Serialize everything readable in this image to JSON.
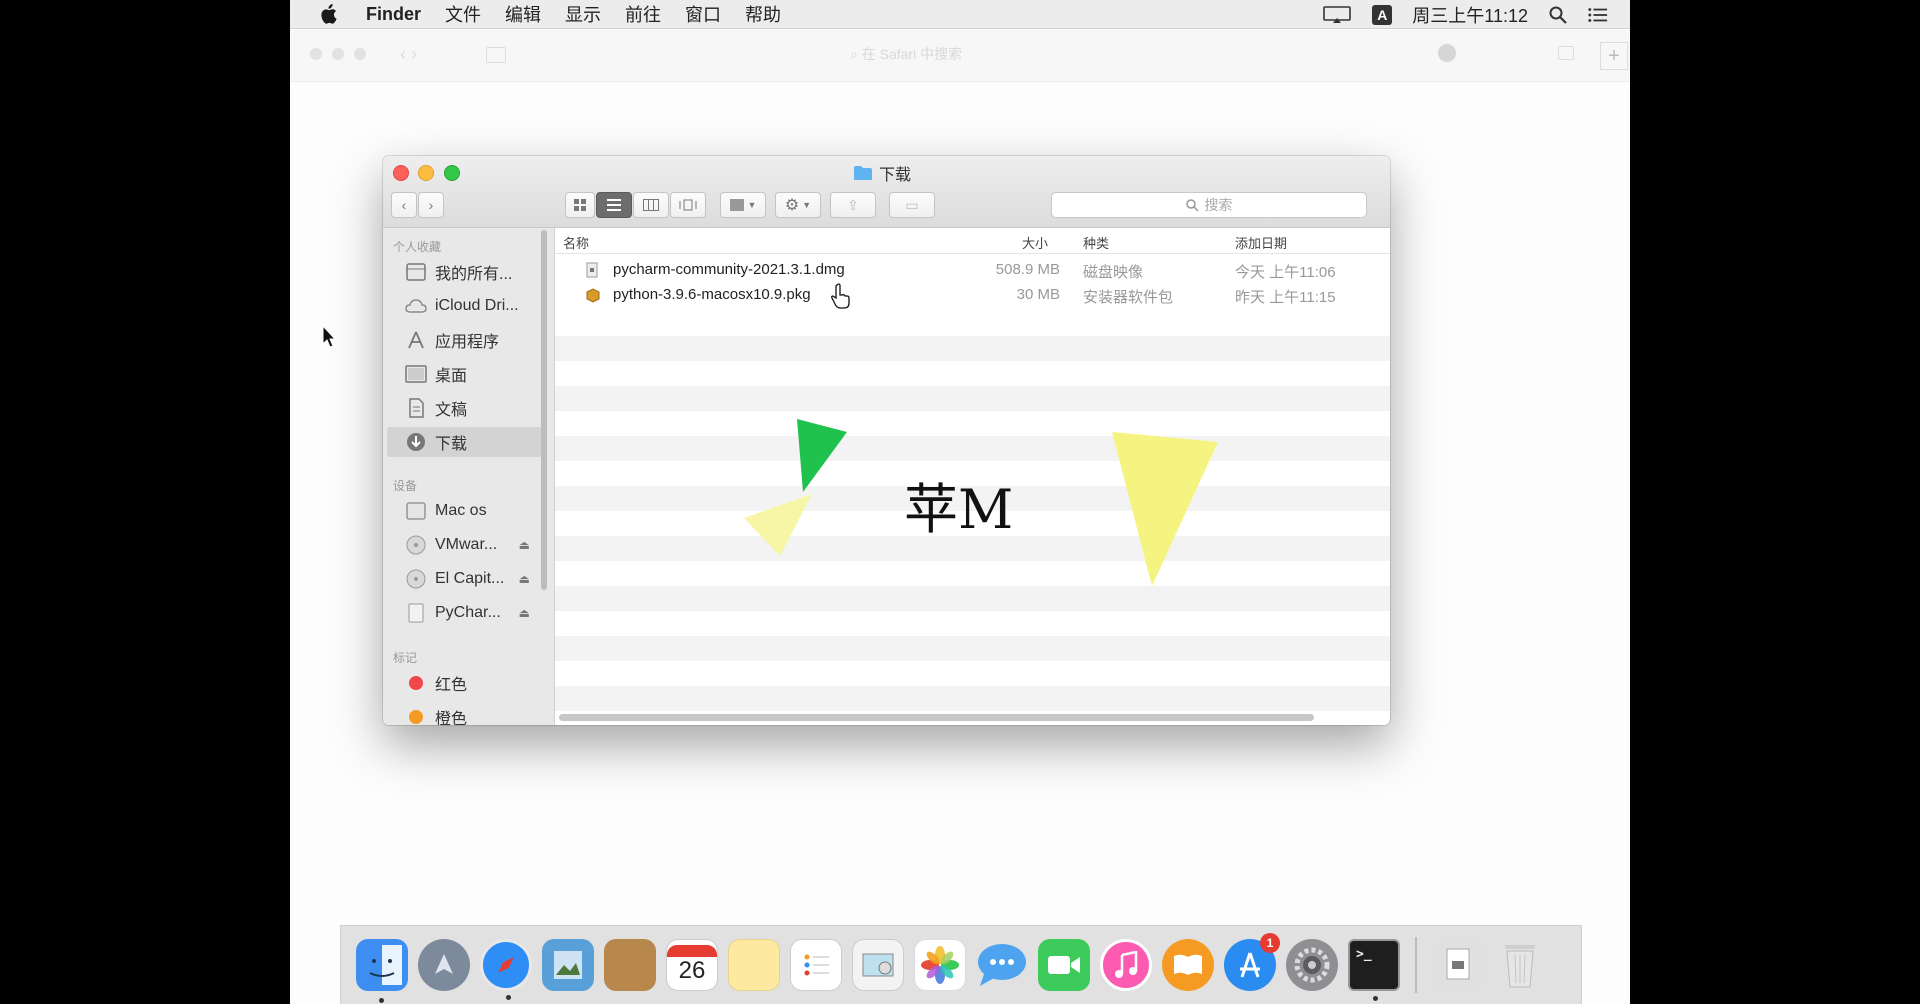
{
  "menubar": {
    "app_name": "Finder",
    "items": [
      "文件",
      "编辑",
      "显示",
      "前往",
      "窗口",
      "帮助"
    ],
    "input_method": "A",
    "clock": "周三上午11:12"
  },
  "browser": {
    "address_placeholder": "在 Safari 中搜索"
  },
  "finder": {
    "title": "下载",
    "search_placeholder": "搜索",
    "sidebar": {
      "section_favorites": "个人收藏",
      "favorites": [
        {
          "label": "我的所有...",
          "icon": "all-files-icon"
        },
        {
          "label": "iCloud Dri...",
          "icon": "cloud-icon"
        },
        {
          "label": "应用程序",
          "icon": "applications-icon"
        },
        {
          "label": "桌面",
          "icon": "desktop-icon"
        },
        {
          "label": "文稿",
          "icon": "documents-icon"
        },
        {
          "label": "下载",
          "icon": "downloads-icon"
        }
      ],
      "section_devices": "设备",
      "devices": [
        {
          "label": "Mac os",
          "icon": "hard-drive-icon"
        },
        {
          "label": "VMwar...",
          "icon": "disc-icon"
        },
        {
          "label": "El Capit...",
          "icon": "disc-icon"
        },
        {
          "label": "PyChar...",
          "icon": "disk-image-icon"
        }
      ],
      "section_tags": "标记",
      "tags": [
        {
          "label": "红色",
          "color": "#f0474a"
        },
        {
          "label": "橙色",
          "color": "#f59a23"
        }
      ]
    },
    "columns": {
      "name": "名称",
      "size": "大小",
      "kind": "种类",
      "date_added": "添加日期"
    },
    "files": [
      {
        "name": "pycharm-community-2021.3.1.dmg",
        "size": "508.9 MB",
        "kind": "磁盘映像",
        "date": "今天 上午11:06",
        "icon": "dmg-file-icon"
      },
      {
        "name": "python-3.9.6-macosx10.9.pkg",
        "size": "30 MB",
        "kind": "安装器软件包",
        "date": "昨天 上午11:15",
        "icon": "pkg-file-icon"
      }
    ]
  },
  "watermark": "苹M",
  "dock": {
    "calendar_day": "26",
    "appstore_badge": "1",
    "colors": {
      "finder": "#3d8ef0",
      "launchpad": "#7d8a9c",
      "safari": "#2f8ef5",
      "preview": "#5aa0d8",
      "notes_book": "#b8874c",
      "calendar": "#ffffff",
      "notes": "#fdeaa0",
      "reminders": "#ffffff",
      "photos_app": "#f3f3f3",
      "photos": "#f4c542",
      "messages": "#4da3f0",
      "facetime": "#3ccb5a",
      "itunes": "#fd5bb1",
      "ibooks": "#f59b23",
      "appstore": "#2a8cf0",
      "settings": "#8e8e93",
      "terminal": "#1e1e1e",
      "downloads_stack": "#e0e0e0",
      "trash": "#d8d8d8"
    }
  }
}
